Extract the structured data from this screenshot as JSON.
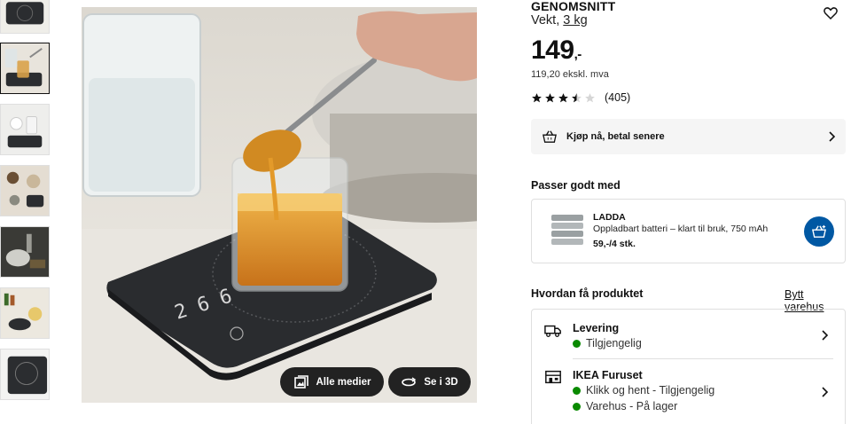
{
  "gallery": {
    "thumbnails": [
      "thumb-1",
      "thumb-2",
      "thumb-3",
      "thumb-4",
      "thumb-5",
      "thumb-6",
      "thumb-7"
    ],
    "active_index": 1,
    "buttons": {
      "all_media": "Alle medier",
      "view_3d": "Se i 3D"
    }
  },
  "product": {
    "name": "GENOMSNITT",
    "desc_prefix": "Vekt, ",
    "desc_link": "3 kg",
    "price_main": "149",
    "price_suffix": ",-",
    "price_ex_vat": "119,20 ekskl. mva",
    "rating": {
      "stars": 3.5,
      "max": 5,
      "count": "(405)"
    }
  },
  "klarna": {
    "label": "Kjøp nå, betal senere"
  },
  "goes_with": {
    "title": "Passer godt med",
    "item": {
      "name": "LADDA",
      "description": "Oppladbart batteri – klart til bruk, 750 mAh",
      "price": "59,-/4 stk."
    }
  },
  "availability": {
    "title": "Hvordan få produktet",
    "change_store": "Bytt varehus",
    "delivery": {
      "title": "Levering",
      "status": "Tilgjengelig"
    },
    "store": {
      "title": "IKEA Furuset",
      "click_collect": "Klikk og hent - Tilgjengelig",
      "stock": "Varehus - På lager"
    }
  },
  "colors": {
    "accent": "#0058a3",
    "available": "#0a8a00",
    "button_dark": "#222222"
  }
}
